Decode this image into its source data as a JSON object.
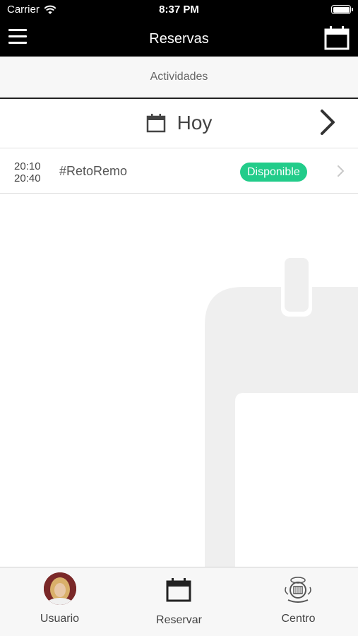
{
  "status_bar": {
    "carrier": "Carrier",
    "time": "8:37 PM"
  },
  "nav": {
    "title": "Reservas",
    "menu_icon": "hamburger-menu-icon",
    "calendar_icon": "calendar-icon"
  },
  "segment": {
    "label": "Actividades"
  },
  "date_selector": {
    "label": "Hoy",
    "icon": "calendar-icon",
    "next_icon": "chevron-right-icon"
  },
  "activities": [
    {
      "start": "20:10",
      "end": "20:40",
      "name": "#RetoRemo",
      "status": "Disponible",
      "status_color": "#22cc8a"
    }
  ],
  "tabs": [
    {
      "label": "Usuario",
      "icon": "user-avatar"
    },
    {
      "label": "Reservar",
      "icon": "calendar-icon"
    },
    {
      "label": "Centro",
      "icon": "club-crest-icon"
    }
  ],
  "colors": {
    "header_bg": "#000000",
    "accent_green": "#22cc8a",
    "illustration_gray": "#efefef"
  }
}
